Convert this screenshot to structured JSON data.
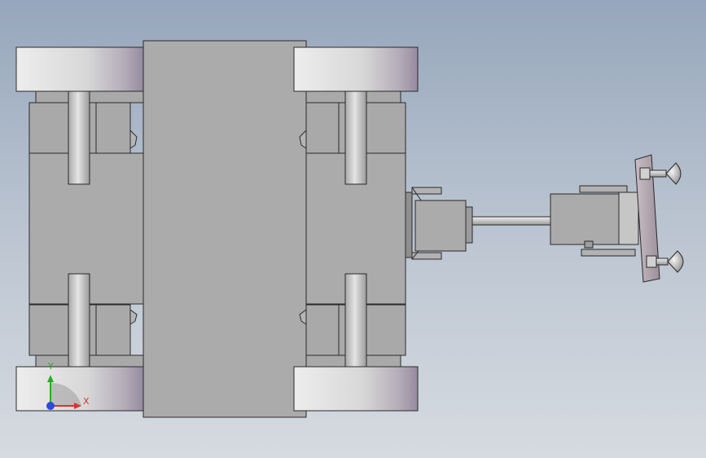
{
  "viewport": {
    "background_top": "#96a6bc",
    "background_bottom": "#d6dbe1"
  },
  "model": {
    "body_color": "#ababab",
    "outline_color": "#2a2a2a",
    "wheel_color_light": "#e2e2e2",
    "wheel_color_dark": "#9d93a3",
    "shaft_color": "#c9c9c9",
    "bracket_color": "#a9a9a9",
    "plate_color": "#b7abb3"
  },
  "triad": {
    "x_label": "X",
    "y_label": "Y",
    "x_color": "#e03030",
    "y_color": "#21b021",
    "z_color": "#2a4ad8"
  }
}
